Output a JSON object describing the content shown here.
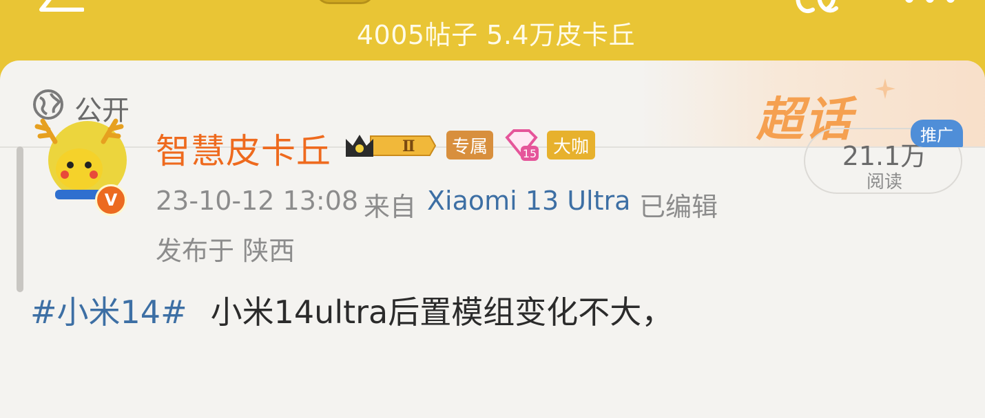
{
  "header": {
    "stats": "4005帖子 5.4万皮卡丘",
    "icons": [
      "back-icon",
      "community-logo",
      "link-icon",
      "more-icon"
    ]
  },
  "visibility": {
    "label": "公开",
    "icon": "globe-icon"
  },
  "banner": {
    "label": "超话"
  },
  "post": {
    "username": "智慧皮卡丘",
    "level": "Ⅱ",
    "tags": {
      "exclusive": "专属",
      "vip_level": "15",
      "bigshot": "大咖"
    },
    "verified": "V",
    "time": "23-10-12 13:08",
    "from_label": "来自",
    "device": "Xiaomi 13 Ultra",
    "edited": "已编辑",
    "location": "发布于 陕西",
    "hashtag": "#小米14#",
    "text": "小米14ultra后置模组变化不大，"
  },
  "reads": {
    "count": "21.1万",
    "label": "阅读",
    "promo": "推广"
  },
  "colors": {
    "header_bg": "#e9c535",
    "username": "#ee6a1e",
    "link": "#3d6fa4",
    "promo": "#4f8ed8"
  }
}
